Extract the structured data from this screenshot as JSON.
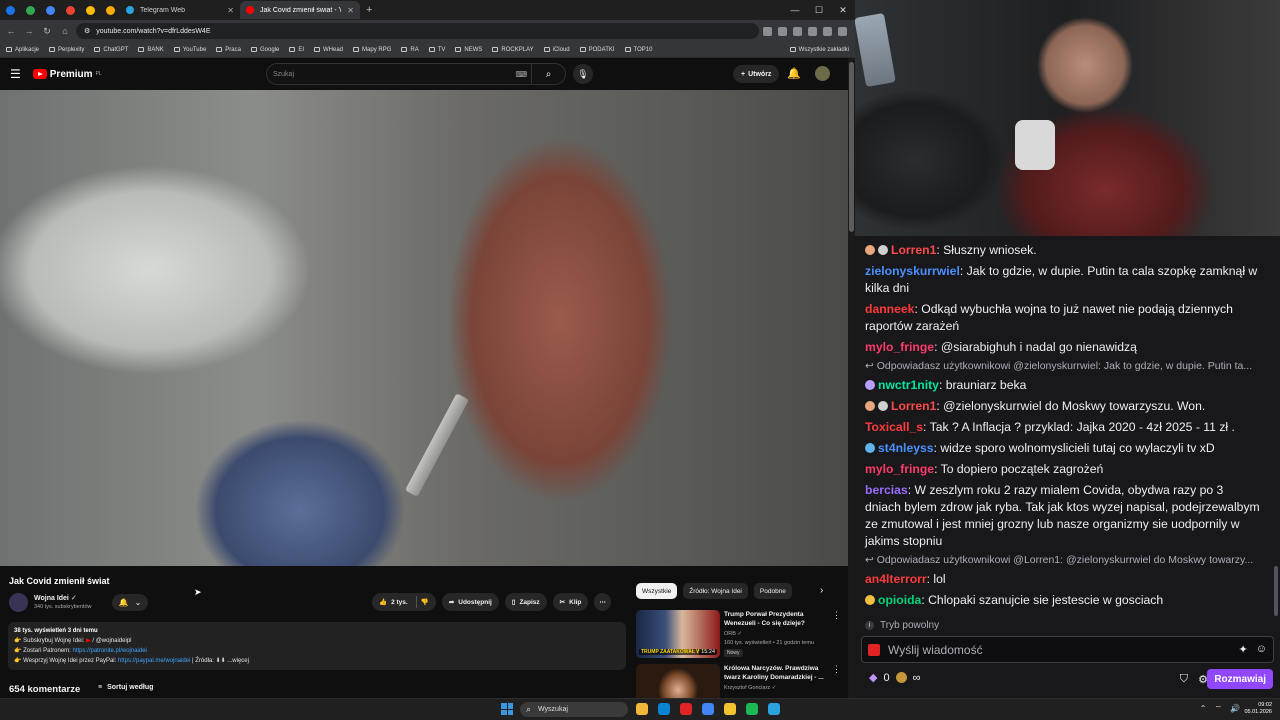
{
  "browser": {
    "tabs": [
      {
        "label": "Telegram Web",
        "favicon_color": "#2aa3df"
      },
      {
        "label": "Jak Covid zmienił świat - Yo",
        "favicon_color": "#ff0000"
      }
    ],
    "mini_tab_colors": [
      "#1a73e8",
      "#34a853",
      "#4285f4",
      "#ea4335",
      "#fbbc04",
      "#f9ab00"
    ],
    "url": "youtube.com/watch?v=dfrLddesW4E",
    "bookmarks": [
      "Aplikacje",
      "Perplexity",
      "ChatGPT",
      "BANK",
      "YouTube",
      "Praca",
      "Google",
      "EI",
      "WHead",
      "Mapy RPG",
      "RA",
      "TV",
      "NEWS",
      "ROCKPLAY",
      "iCloud",
      "PODATKI",
      "TOP10"
    ],
    "bookmarks_right": "Wszystkie zakładki",
    "min": "—",
    "max": "☐",
    "close": "✕"
  },
  "youtube": {
    "logo": "Premium",
    "logo_sup": "PL",
    "search_placeholder": "Szukaj",
    "create_label": "Utwórz",
    "video_title": "Jak Covid zmienił świat",
    "channel_name": "Wojna Idei",
    "channel_subs": "340 tys. subskrybentów",
    "likes": "2 tys.",
    "share_label": "Udostępnij",
    "save_label": "Zapisz",
    "clip_label": "Klip",
    "description": {
      "stats": "38 tys. wyświetleń  3 dni temu",
      "line1_prefix": "👉 Subskrybuj Wojnę Idei: ",
      "line1_handle": " / @wojnaideipl",
      "line2_prefix": "👉 Zostań Patronem: ",
      "line2_link": "https://patronite.pl/wojnaidei",
      "line3_prefix": "👉 Wesprzyj Wojnę Idei przez PayPal: ",
      "line3_link": "https://paypal.me/wojnaidei",
      "line3_suffix": "   |   Źródła: ⬇⬇ ...więcej"
    },
    "comments_count": "654 komentarze",
    "sort_label": "Sortuj według",
    "chips": [
      "Wszystkie",
      "Źródło: Wojna Idei",
      "Podobne"
    ],
    "recommendations": [
      {
        "title": "Trump Porwał Prezydenta Wenezueli - Co się dzieje?",
        "channel": "ORB",
        "meta": "160 tys. wyświetleń • 21 godzin temu",
        "badge": "Nowy",
        "duration": "15:24",
        "thumb_text": "TRUMP ZAATAKOWAŁ WEN"
      },
      {
        "title": "Królowa Narcyzów. Prawdziwa twarz Karoliny Domaradzkiej - ...",
        "channel": "Krzysztof Gonciarz"
      }
    ]
  },
  "chat": {
    "messages": [
      {
        "type": "msg",
        "user": "Lorren1",
        "color": "#ff4a4a",
        "badges": [
          "#e8a87c",
          "#cfcfcf"
        ],
        "text": ": Słuszny wniosek."
      },
      {
        "type": "msg",
        "user": "zielonyskurrwiel",
        "color": "#4a90ff",
        "badges": [],
        "text": ": Jak to gdzie, w dupie. Putin ta cala szopkę zamknął w kilka dni"
      },
      {
        "type": "msg",
        "user": "danneek",
        "color": "#ff3b3b",
        "badges": [],
        "text": ": Odkąd wybuchła wojna to już nawet nie podają dziennych raportów zarażeń"
      },
      {
        "type": "msg",
        "user": "mylo_fringe",
        "color": "#ff3b6b",
        "badges": [],
        "text": ": @siarabighuh i nadal go nienawidzą"
      },
      {
        "type": "reply",
        "text": "Odpowiadasz użytkownikowi @zielonyskurrwiel: Jak to gdzie, w dupie. Putin ta..."
      },
      {
        "type": "msg",
        "user": "nwctr1nity",
        "color": "#00e5a0",
        "badges": [
          "#b8a0ff"
        ],
        "text": ": brauniarz beka"
      },
      {
        "type": "msg",
        "user": "Lorren1",
        "color": "#ff4a4a",
        "badges": [
          "#e8a87c",
          "#cfcfcf"
        ],
        "text": ": @zielonyskurrwiel do Moskwy towarzyszu. Won."
      },
      {
        "type": "msg",
        "user": "Toxicall_s",
        "color": "#ff3b3b",
        "badges": [],
        "text": ": Tak ? A Inflacja ? przyklad: Jajka 2020 - 4zł 2025 - 11 zł ."
      },
      {
        "type": "msg",
        "user": "st4nleyss",
        "color": "#4a90ff",
        "badges": [
          "#5fb3e8"
        ],
        "text": ": widze sporo wolnomyslicieli tutaj co wylaczyli tv xD"
      },
      {
        "type": "msg",
        "user": "mylo_fringe",
        "color": "#ff3b6b",
        "badges": [],
        "text": ": To dopiero początek zagrożeń"
      },
      {
        "type": "msg",
        "user": "bercias",
        "color": "#9b6bff",
        "badges": [],
        "text": ": W zeszlym roku 2 razy mialem Covida, obydwa razy po 3 dniach bylem zdrow jak ryba. Tak jak ktos wyzej napisal, podejrzewalbym ze zmutowal i jest mniej grozny lub nasze organizmy sie uodpornily w jakims stopniu"
      },
      {
        "type": "reply",
        "text": "Odpowiadasz użytkownikowi @Lorren1: @zielonyskurrwiel do Moskwy towarzy..."
      },
      {
        "type": "msg",
        "user": "an4lterrorr",
        "color": "#ff3b3b",
        "badges": [],
        "text": ": lol"
      },
      {
        "type": "msg",
        "user": "opioida",
        "color": "#00d47a",
        "badges": [
          "#f0c040"
        ],
        "text": ": Chlopaki szanujcie sie jestescie w gosciach"
      }
    ],
    "slow_mode": "Tryb powolny",
    "input_placeholder": "Wyślij wiadomość",
    "points": "0",
    "infinity": "∞",
    "send_label": "Rozmawiaj"
  },
  "taskbar": {
    "search_label": "Wyszukaj",
    "time": "09:02",
    "date": "05.01.2026",
    "app_colors": [
      "#f0b73a",
      "#0a84d0",
      "#e02424",
      "#4285f4",
      "#f4c430",
      "#1db954",
      "#2aa3df"
    ]
  }
}
